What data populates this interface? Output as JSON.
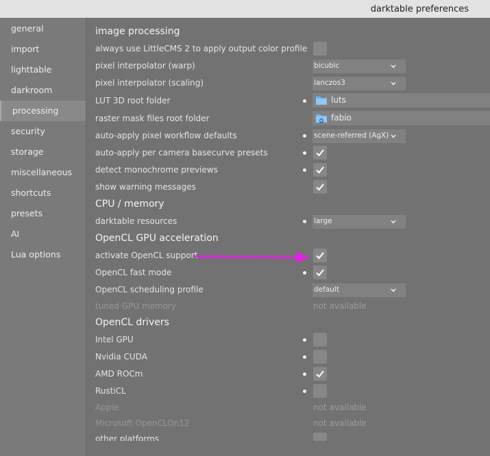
{
  "window": {
    "title": "darktable preferences"
  },
  "sidebar": {
    "items": [
      {
        "label": "general"
      },
      {
        "label": "import"
      },
      {
        "label": "lighttable"
      },
      {
        "label": "darkroom"
      },
      {
        "label": "processing"
      },
      {
        "label": "security"
      },
      {
        "label": "storage"
      },
      {
        "label": "miscellaneous"
      },
      {
        "label": "shortcuts"
      },
      {
        "label": "presets"
      },
      {
        "label": "AI"
      },
      {
        "label": "Lua options"
      }
    ],
    "active": "processing"
  },
  "sections": {
    "image_processing": {
      "title": "image processing",
      "lcms": {
        "label": "always use LittleCMS 2 to apply output color profile",
        "checked": false
      },
      "interp_warp": {
        "label": "pixel interpolator (warp)",
        "value": "bicubic"
      },
      "interp_scaling": {
        "label": "pixel interpolator (scaling)",
        "value": "lanczos3"
      },
      "lut_root": {
        "label": "LUT 3D root folder",
        "value": "luts"
      },
      "raster_root": {
        "label": "raster mask files root folder",
        "value": "fabio"
      },
      "workflow": {
        "label": "auto-apply pixel workflow defaults",
        "value": "scene-referred (AgX)"
      },
      "basecurve": {
        "label": "auto-apply per camera basecurve presets",
        "checked": true
      },
      "monochrome": {
        "label": "detect monochrome previews",
        "checked": true
      },
      "warnings": {
        "label": "show warning messages",
        "checked": true
      }
    },
    "cpu": {
      "title": "CPU / memory",
      "resources": {
        "label": "darktable resources",
        "value": "large"
      }
    },
    "opencl": {
      "title": "OpenCL GPU acceleration",
      "activate": {
        "label": "activate OpenCL support",
        "checked": true
      },
      "fast": {
        "label": "OpenCL fast mode",
        "checked": true
      },
      "profile": {
        "label": "OpenCL scheduling profile",
        "value": "default"
      },
      "tuned": {
        "label": "tuned GPU memory",
        "value": "not available"
      }
    },
    "drivers": {
      "title": "OpenCL drivers",
      "intel": {
        "label": "Intel GPU",
        "checked": false
      },
      "nvidia": {
        "label": "Nvidia CUDA",
        "checked": false
      },
      "amd": {
        "label": "AMD ROCm",
        "checked": true
      },
      "rusticl": {
        "label": "RustiCL",
        "checked": false
      },
      "apple": {
        "label": "Apple",
        "value": "not available"
      },
      "microsoft": {
        "label": "Microsoft OpenCLOn12",
        "value": "not available"
      },
      "other": {
        "label": "other platforms",
        "checked": false
      }
    }
  },
  "colors": {
    "annotation_arrow": "#e61ee6",
    "accent_folder": "#6cb6f4"
  }
}
